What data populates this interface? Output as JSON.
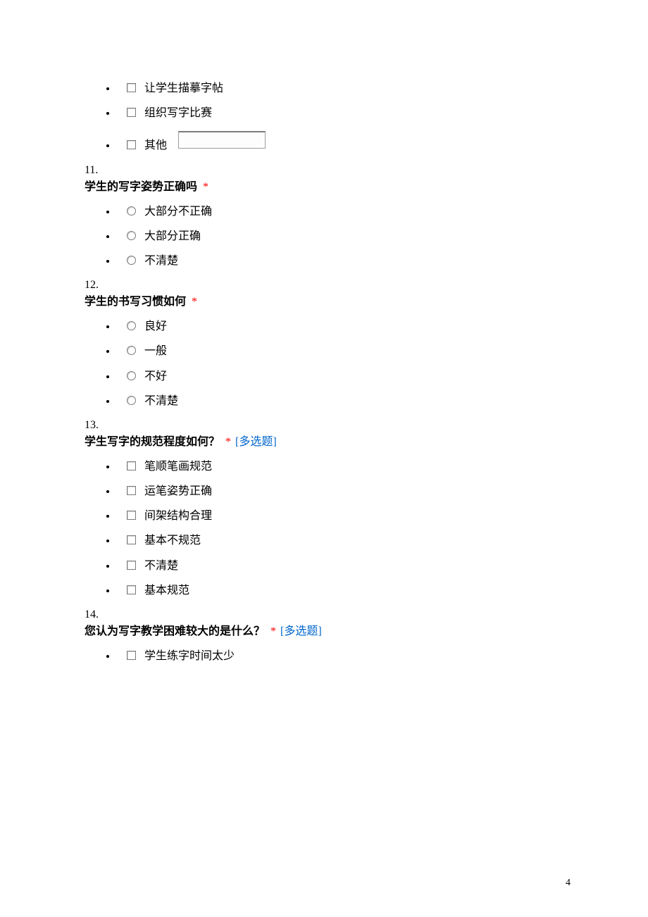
{
  "required_mark": "*",
  "multi_mark": "[多选题]",
  "q10_extra_options": [
    {
      "label": "让学生描摹字帖"
    },
    {
      "label": "组织写字比赛"
    },
    {
      "label": "其他",
      "has_input": true
    }
  ],
  "q11": {
    "number": "11.",
    "title": "学生的写字姿势正确吗",
    "options": [
      "大部分不正确",
      "大部分正确",
      "不清楚"
    ]
  },
  "q12": {
    "number": "12.",
    "title": "学生的书写习惯如何",
    "options": [
      "良好",
      "一般",
      "不好",
      "不清楚"
    ]
  },
  "q13": {
    "number": "13.",
    "title": "学生写字的规范程度如何？",
    "options": [
      "笔顺笔画规范",
      "运笔姿势正确",
      "间架结构合理",
      "基本不规范",
      "不清楚",
      "基本规范"
    ]
  },
  "q14": {
    "number": "14.",
    "title": "您认为写字教学困难较大的是什么？",
    "options": [
      "学生练字时间太少"
    ]
  },
  "page_number": "4"
}
